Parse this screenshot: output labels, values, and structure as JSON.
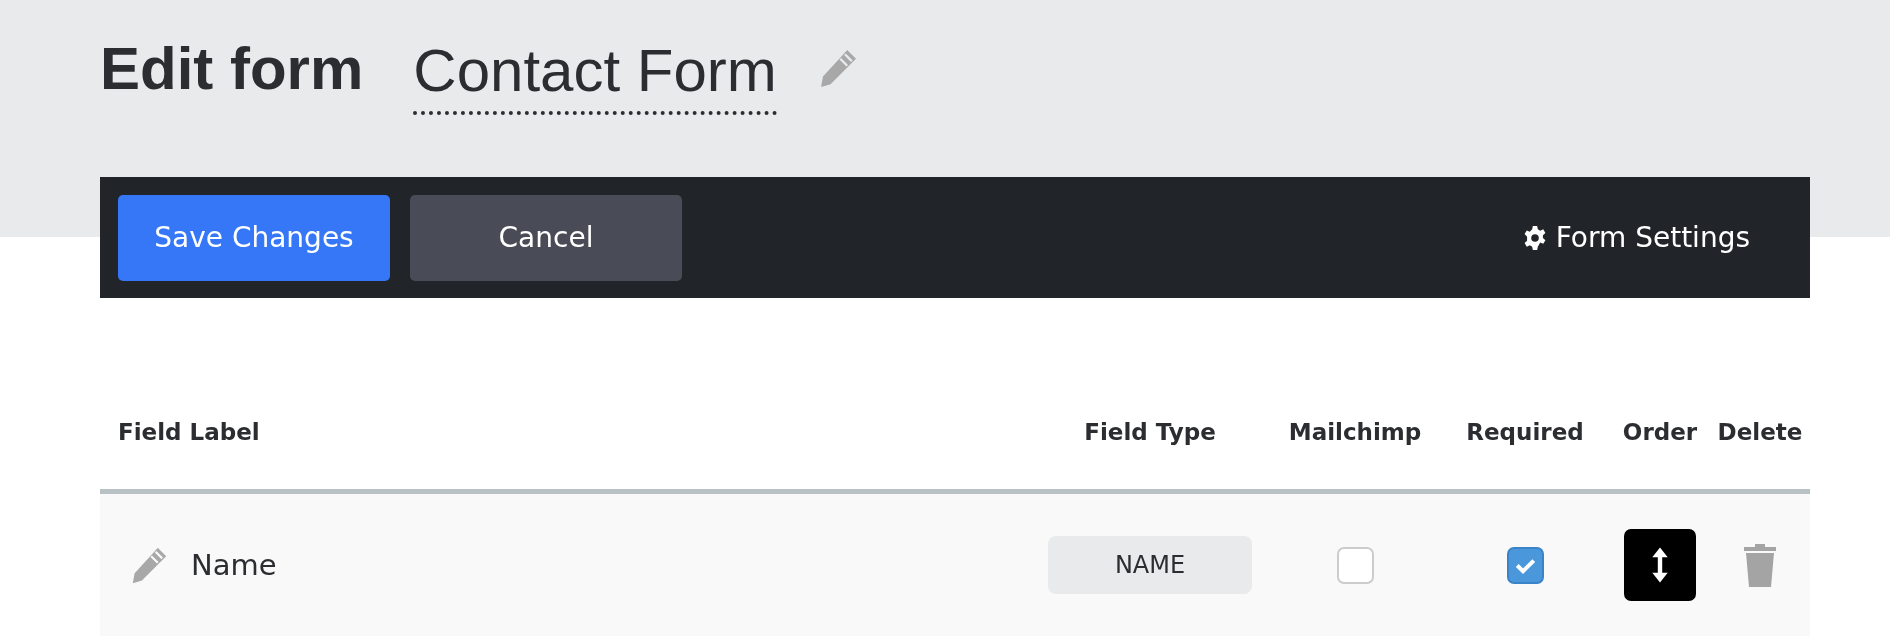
{
  "header": {
    "title": "Edit form",
    "form_name": "Contact Form"
  },
  "toolbar": {
    "buttons": [
      {
        "label": "Save Changes",
        "kind": "primary"
      },
      {
        "label": "Cancel",
        "kind": "secondary"
      }
    ],
    "settings": "Form Settings"
  },
  "table": {
    "columns": [
      "Field Label",
      "Field Type",
      "Mailchimp",
      "Required",
      "Order",
      "Delete"
    ],
    "rows": [
      {
        "label": "Name",
        "type": "NAME",
        "mailchimp": false,
        "required": true
      }
    ]
  }
}
